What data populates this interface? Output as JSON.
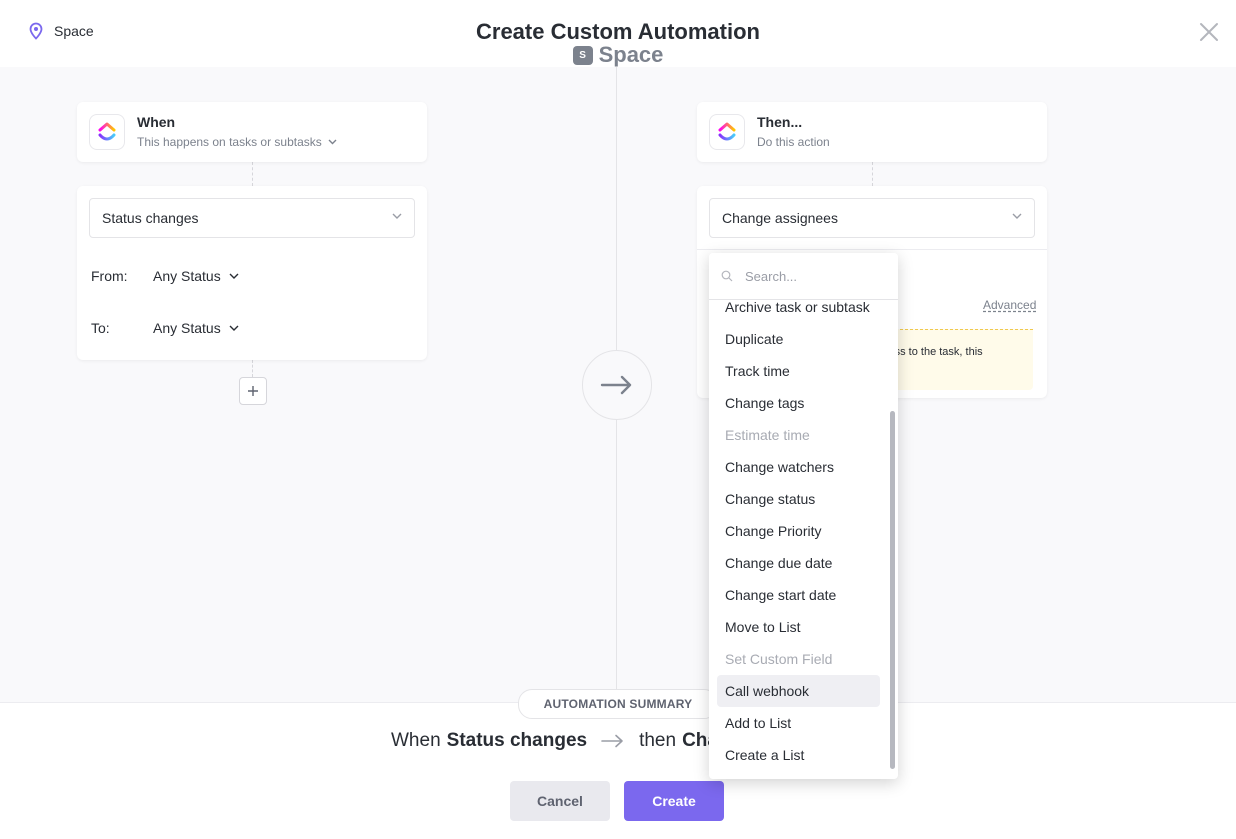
{
  "header": {
    "location": "Space",
    "title": "Create Custom Automation",
    "space_badge": "S",
    "space_name": "Space"
  },
  "trigger": {
    "heading": "When",
    "subheading": "This happens on tasks or subtasks",
    "selected": "Status changes",
    "from_label": "From:",
    "from_value": "Any Status",
    "to_label": "To:",
    "to_value": "Any Status"
  },
  "action": {
    "heading": "Then...",
    "subheading": "Do this action",
    "selected": "Change assignees",
    "advanced_label": "Advanced",
    "notice_partial": "cess to the task, this"
  },
  "dropdown": {
    "search_placeholder": "Search...",
    "items": [
      {
        "label": "Archive task or subtask",
        "disabled": false
      },
      {
        "label": "Duplicate",
        "disabled": false
      },
      {
        "label": "Track time",
        "disabled": false
      },
      {
        "label": "Change tags",
        "disabled": false
      },
      {
        "label": "Estimate time",
        "disabled": true
      },
      {
        "label": "Change watchers",
        "disabled": false
      },
      {
        "label": "Change status",
        "disabled": false
      },
      {
        "label": "Change Priority",
        "disabled": false
      },
      {
        "label": "Change due date",
        "disabled": false
      },
      {
        "label": "Change start date",
        "disabled": false
      },
      {
        "label": "Move to List",
        "disabled": false
      },
      {
        "label": "Set Custom Field",
        "disabled": true
      },
      {
        "label": "Call webhook",
        "disabled": false,
        "highlighted": true
      },
      {
        "label": "Add to List",
        "disabled": false
      },
      {
        "label": "Create a List",
        "disabled": false
      }
    ]
  },
  "summary": {
    "pill": "AUTOMATION SUMMARY",
    "when_word": "When",
    "trigger_bold": "Status changes",
    "then_word": "then",
    "action_bold_partial": "Cha"
  },
  "buttons": {
    "cancel": "Cancel",
    "create": "Create"
  },
  "colors": {
    "accent": "#7b68ee",
    "canvas_bg": "#f9f9fb",
    "notice_bg": "#fffbea"
  }
}
